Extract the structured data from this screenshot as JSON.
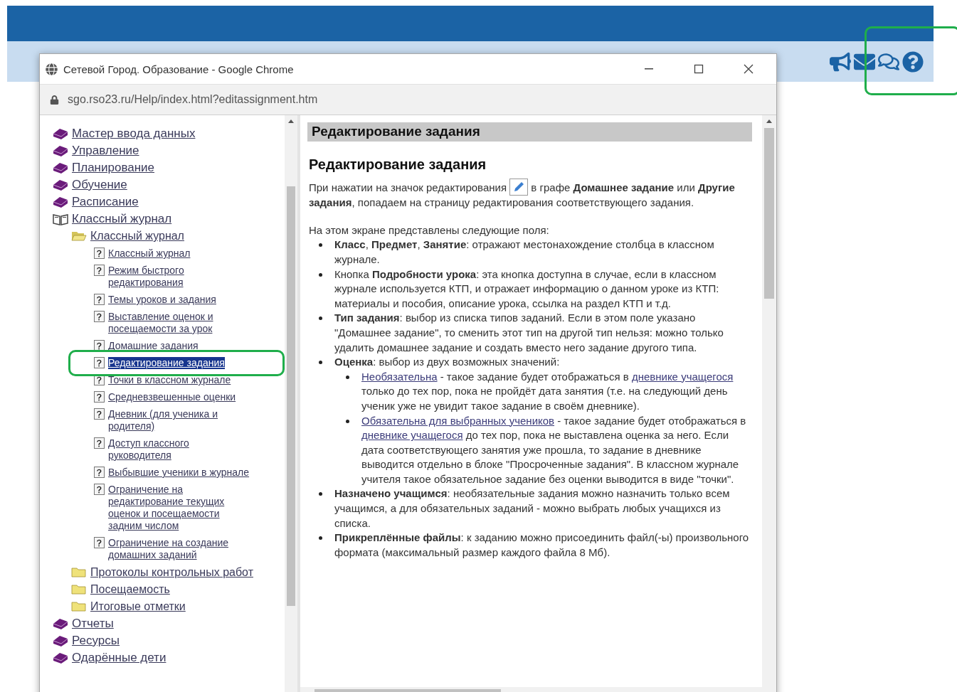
{
  "popup": {
    "title": "Сетевой Город. Образование - Google Chrome",
    "url": "sgo.rso23.ru/Help/index.html?editassignment.htm"
  },
  "tree": [
    {
      "label": "Мастер ввода данных",
      "kind": "book",
      "expanded": false,
      "selected": false
    },
    {
      "label": "Управление",
      "kind": "book",
      "expanded": false,
      "selected": false
    },
    {
      "label": "Планирование",
      "kind": "book",
      "expanded": false,
      "selected": false
    },
    {
      "label": "Обучение",
      "kind": "book",
      "expanded": false,
      "selected": false
    },
    {
      "label": "Расписание",
      "kind": "book",
      "expanded": false,
      "selected": false
    },
    {
      "label": "Классный журнал",
      "kind": "book",
      "expanded": true,
      "selected": false,
      "children": [
        {
          "label": "Классный журнал",
          "kind": "folder",
          "expanded": true,
          "selected": false,
          "children": [
            {
              "label": "Классный журнал",
              "kind": "page",
              "selected": false
            },
            {
              "label": "Режим быстрого редактирования",
              "kind": "page",
              "selected": false
            },
            {
              "label": "Темы уроков и задания",
              "kind": "page",
              "selected": false
            },
            {
              "label": "Выставление оценок и посещаемости за урок",
              "kind": "page",
              "selected": false
            },
            {
              "label": "Домашние задания",
              "kind": "page",
              "selected": false
            },
            {
              "label": "Редактирование задания",
              "kind": "page",
              "selected": true
            },
            {
              "label": "Точки в классном журнале",
              "kind": "page",
              "selected": false
            },
            {
              "label": "Средневзвешенные оценки",
              "kind": "page",
              "selected": false
            },
            {
              "label": "Дневник (для ученика и родителя)",
              "kind": "page",
              "selected": false
            },
            {
              "label": "Доступ классного руководителя",
              "kind": "page",
              "selected": false
            },
            {
              "label": "Выбывшие ученики в журнале",
              "kind": "page",
              "selected": false
            },
            {
              "label": "Ограничение на редактирование текущих оценок и посещаемости задним числом",
              "kind": "page",
              "selected": false
            },
            {
              "label": "Ограничение на создание домашних заданий",
              "kind": "page",
              "selected": false
            }
          ]
        },
        {
          "label": "Протоколы контрольных работ",
          "kind": "folder",
          "expanded": false,
          "selected": false
        },
        {
          "label": "Посещаемость",
          "kind": "folder",
          "expanded": false,
          "selected": false
        },
        {
          "label": "Итоговые отметки",
          "kind": "folder",
          "expanded": false,
          "selected": false
        }
      ]
    },
    {
      "label": "Отчеты",
      "kind": "book",
      "expanded": false,
      "selected": false
    },
    {
      "label": "Ресурсы",
      "kind": "book",
      "expanded": false,
      "selected": false
    },
    {
      "label": "Одарённые дети",
      "kind": "book",
      "expanded": false,
      "selected": false
    }
  ],
  "article": {
    "banner": "Редактирование задания",
    "heading": "Редактирование задания",
    "intro": [
      {
        "kind": "text",
        "text": "При нажатии на значок редактирования "
      },
      {
        "kind": "icon"
      },
      {
        "kind": "text",
        "text": " в графе **Домашнее задание** или **Другие задания**, попадаем на страницу редактирования соответствующего задания."
      }
    ],
    "fields_intro": "На этом экране представлены следующие поля:",
    "fields": [
      {
        "segments": [
          {
            "kind": "text",
            "text": "**Класс**, **Предмет**, **Занятие**: отражают местонахождение столбца в классном журнале."
          }
        ]
      },
      {
        "segments": [
          {
            "kind": "text",
            "text": "Кнопка **Подробности урока**: эта кнопка доступна в случае, если в классном журнале используется КТП, и отражает информацию о данном уроке из КТП: материалы и пособия, описание урока, ссылка на раздел КТП и т.д."
          }
        ]
      },
      {
        "segments": [
          {
            "kind": "text",
            "text": "**Тип задания**: выбор из списка типов заданий. Если в этом поле указано \"Домашнее задание\", то сменить этот тип на другой тип нельзя: можно только удалить домашнее задание и создать вместо него задание другого типа."
          }
        ]
      },
      {
        "segments": [
          {
            "kind": "text",
            "text": "**Оценка**: выбор из двух возможных значений:"
          }
        ],
        "children": [
          {
            "segments": [
              {
                "kind": "link",
                "text": "Необязательна"
              },
              {
                "kind": "text",
                "text": " - такое задание будет отображаться в "
              },
              {
                "kind": "link",
                "text": "дневнике учащегося"
              },
              {
                "kind": "text",
                "text": " только до тех пор, пока не пройдёт дата занятия (т.е. на следующий день ученик уже не увидит такое задание в своём дневнике)."
              }
            ]
          },
          {
            "segments": [
              {
                "kind": "link",
                "text": "Обязательна для выбранных учеников"
              },
              {
                "kind": "text",
                "text": " - такое задание будет отображаться в "
              },
              {
                "kind": "link",
                "text": "дневнике учащегося"
              },
              {
                "kind": "text",
                "text": " до тех пор, пока не выставлена оценка за него. Если дата соответствующего занятия уже прошла, то задание в дневнике выводится отдельно в блоке \"Просроченные задания\". В классном журнале учителя такое обязательное задание без оценки выводится в виде \"точки\"."
              }
            ]
          }
        ]
      },
      {
        "segments": [
          {
            "kind": "text",
            "text": "**Назначено учащимся**: необязательные задания можно назначить только всем учащимся, а для обязательных заданий - можно выбрать любых учащихся из списка."
          }
        ]
      },
      {
        "segments": [
          {
            "kind": "text",
            "text": "**Прикреплённые файлы**: к заданию можно присоединить файл(-ы) произвольного формата (максимальный размер каждого файла 8 Мб)."
          }
        ]
      }
    ]
  }
}
